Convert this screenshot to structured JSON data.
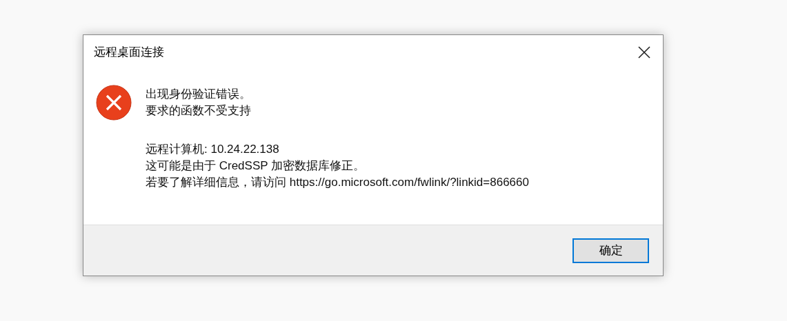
{
  "window": {
    "title": "远程桌面连接"
  },
  "message": {
    "kind": "error",
    "paragraphs": [
      [
        "出现身份验证错误。",
        "要求的函数不受支持"
      ],
      [
        "远程计算机: 10.24.22.138",
        "这可能是由于 CredSSP 加密数据库修正。",
        "若要了解详细信息，请访问 https://go.microsoft.com/fwlink/?linkid=866660"
      ]
    ]
  },
  "buttons": [
    {
      "label": "确定",
      "focused": true
    }
  ]
}
